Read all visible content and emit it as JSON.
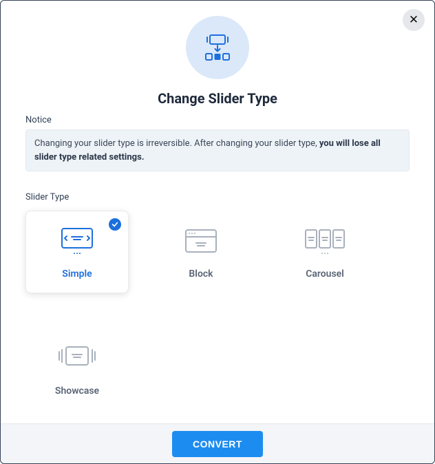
{
  "title": "Change Slider Type",
  "notice": {
    "label": "Notice",
    "text_before": "Changing your slider type is irreversible. After changing your slider type, ",
    "text_bold": "you will lose all slider type related settings."
  },
  "slider_type": {
    "label": "Slider Type",
    "options": {
      "simple": "Simple",
      "block": "Block",
      "carousel": "Carousel",
      "showcase": "Showcase"
    },
    "selected": "simple"
  },
  "footer": {
    "convert": "CONVERT"
  },
  "colors": {
    "accent": "#1d6fdc",
    "icon_gray": "#a8b0bc",
    "primary_btn": "#1d8cf0"
  }
}
